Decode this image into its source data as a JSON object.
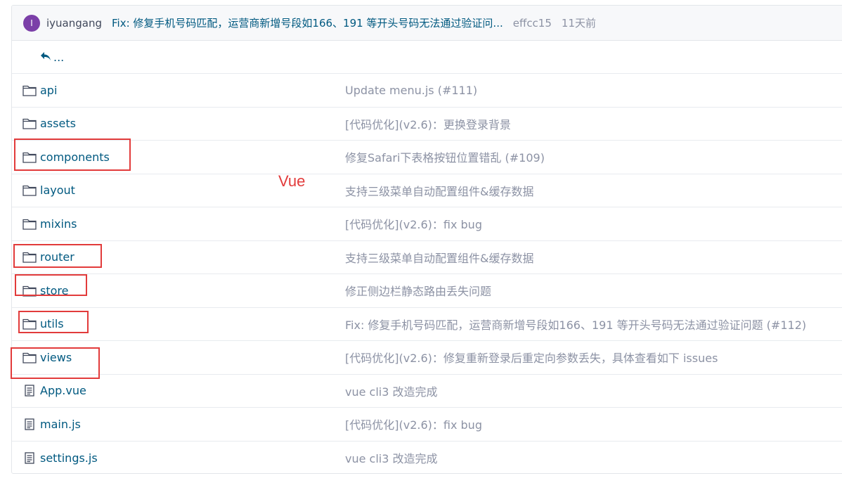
{
  "commit": {
    "avatar_letter": "I",
    "author": "iyuangang",
    "message": "Fix: 修复手机号码匹配，运营商新增号段如166、191 等开头号码无法通过验证问...",
    "hash": "effcc15",
    "time": "11天前"
  },
  "back": {
    "label": "..."
  },
  "files": [
    {
      "type": "folder",
      "name": "api",
      "commit": "Update menu.js (#111)"
    },
    {
      "type": "folder",
      "name": "assets",
      "commit": "[代码优化](v2.6)：更换登录背景"
    },
    {
      "type": "folder",
      "name": "components",
      "commit": "修复Safari下表格按钮位置错乱 (#109)"
    },
    {
      "type": "folder",
      "name": "layout",
      "commit": "支持三级菜单自动配置组件&缓存数据"
    },
    {
      "type": "folder",
      "name": "mixins",
      "commit": "[代码优化](v2.6)：fix bug"
    },
    {
      "type": "folder",
      "name": "router",
      "commit": "支持三级菜单自动配置组件&缓存数据"
    },
    {
      "type": "folder",
      "name": "store",
      "commit": "修正侧边栏静态路由丢失问题"
    },
    {
      "type": "folder",
      "name": "utils",
      "commit": "Fix: 修复手机号码匹配，运营商新增号段如166、191 等开头号码无法通过验证问题 (#112)"
    },
    {
      "type": "folder",
      "name": "views",
      "commit": "[代码优化](v2.6)：修复重新登录后重定向参数丢失，具体查看如下 issues"
    },
    {
      "type": "file",
      "name": "App.vue",
      "commit": "vue cli3 改造完成"
    },
    {
      "type": "file",
      "name": "main.js",
      "commit": "[代码优化](v2.6)：fix bug"
    },
    {
      "type": "file",
      "name": "settings.js",
      "commit": "vue cli3 改造完成"
    }
  ],
  "annotation": {
    "label": "Vue",
    "color": "#e23b3b"
  },
  "colors": {
    "link": "#005980",
    "muted": "#8c92a4",
    "avatar": "#7b3fa8"
  }
}
